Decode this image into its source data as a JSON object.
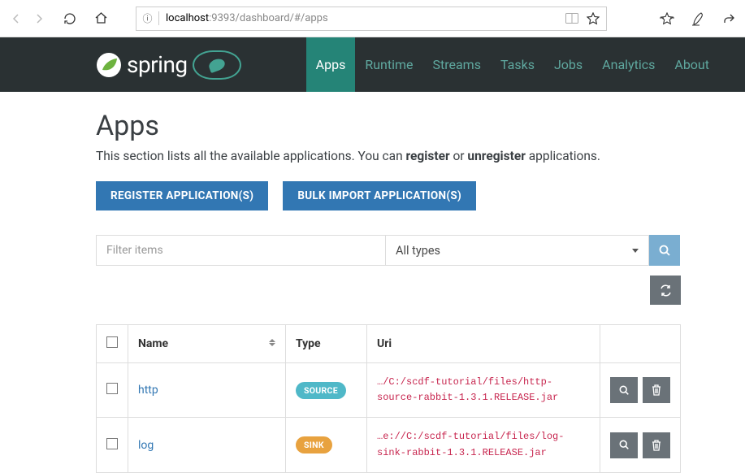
{
  "browser": {
    "url_host": "localhost",
    "url_path": ":9393/dashboard/#/apps"
  },
  "nav": {
    "brand": "spring",
    "links": [
      "Apps",
      "Runtime",
      "Streams",
      "Tasks",
      "Jobs",
      "Analytics",
      "About"
    ],
    "active": 0
  },
  "page": {
    "title": "Apps",
    "desc_pre": "This section lists all the available applications. You can ",
    "desc_bold1": "register",
    "desc_mid": " or ",
    "desc_bold2": "unregister",
    "desc_post": " applications."
  },
  "buttons": {
    "register": "REGISTER APPLICATION(S)",
    "bulk": "BULK IMPORT APPLICATION(S)"
  },
  "filter": {
    "placeholder": "Filter items",
    "type_label": "All types"
  },
  "table": {
    "headers": {
      "name": "Name",
      "type": "Type",
      "uri": "Uri"
    },
    "rows": [
      {
        "name": "http",
        "type": "SOURCE",
        "type_class": "source",
        "uri": "…/C:/scdf-tutorial/files/http-source-rabbit-1.3.1.RELEASE.jar"
      },
      {
        "name": "log",
        "type": "SINK",
        "type_class": "sink",
        "uri": "…e://C:/scdf-tutorial/files/log-sink-rabbit-1.3.1.RELEASE.jar"
      }
    ]
  }
}
